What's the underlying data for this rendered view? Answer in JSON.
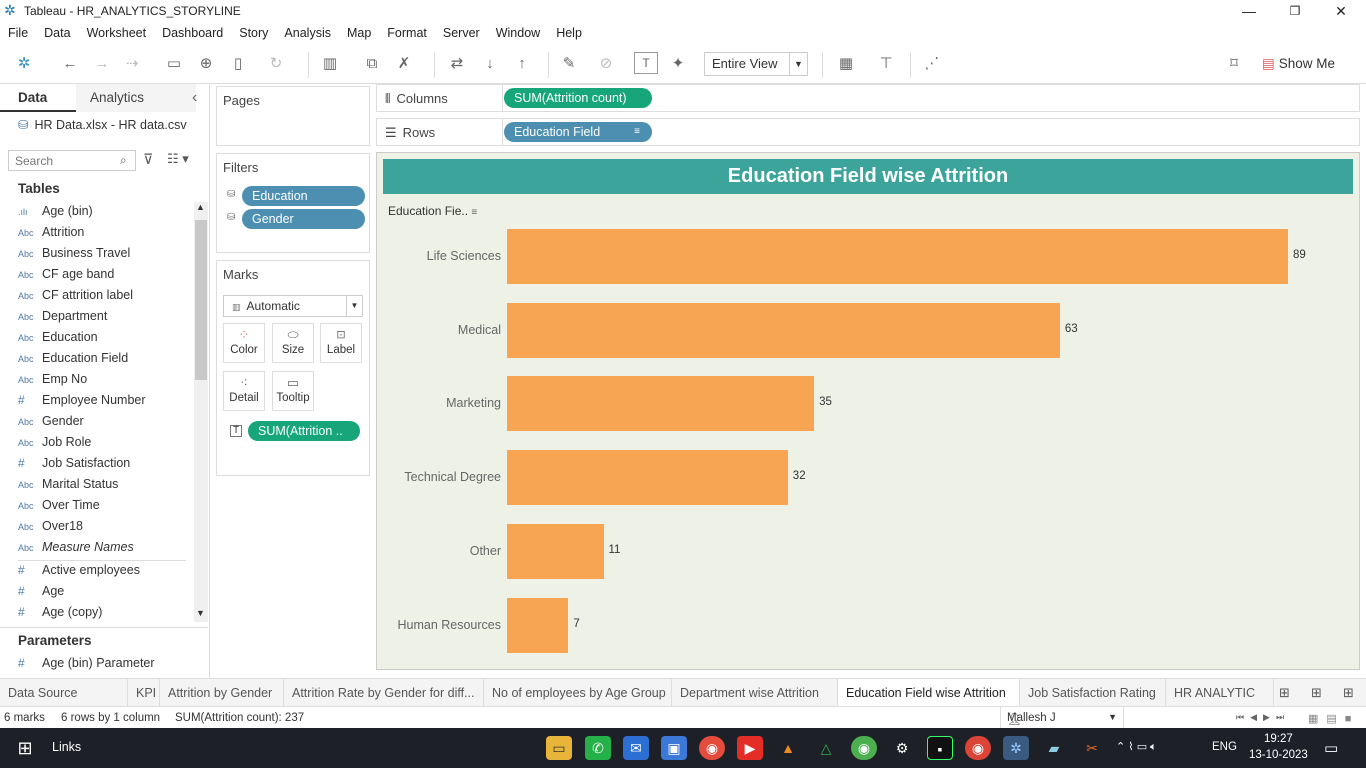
{
  "window": {
    "title": "Tableau - HR_ANALYTICS_STORYLINE",
    "minimize": "—",
    "restore": "❐",
    "close": "✕"
  },
  "menu": [
    "File",
    "Data",
    "Worksheet",
    "Dashboard",
    "Story",
    "Analysis",
    "Map",
    "Format",
    "Server",
    "Window",
    "Help"
  ],
  "toolbar": {
    "fit_label": "Entire View",
    "show_me_label": "Show Me"
  },
  "left_pane": {
    "tab_data": "Data",
    "tab_analytics": "Analytics",
    "collapse_icon": "‹",
    "datasource": "HR Data.xlsx - HR data.csv",
    "search_placeholder": "Search",
    "tables_header": "Tables",
    "fields": [
      {
        "type": "bin",
        "name": "Age (bin)"
      },
      {
        "type": "Abc",
        "name": "Attrition"
      },
      {
        "type": "Abc",
        "name": "Business Travel"
      },
      {
        "type": "Abc",
        "name": "CF age band"
      },
      {
        "type": "Abc",
        "name": "CF attrition label"
      },
      {
        "type": "Abc",
        "name": "Department"
      },
      {
        "type": "Abc",
        "name": "Education"
      },
      {
        "type": "Abc",
        "name": "Education Field"
      },
      {
        "type": "Abc",
        "name": "Emp No"
      },
      {
        "type": "#",
        "name": "Employee Number"
      },
      {
        "type": "Abc",
        "name": "Gender"
      },
      {
        "type": "Abc",
        "name": "Job Role"
      },
      {
        "type": "#",
        "name": "Job Satisfaction"
      },
      {
        "type": "Abc",
        "name": "Marital Status"
      },
      {
        "type": "Abc",
        "name": "Over Time"
      },
      {
        "type": "Abc",
        "name": "Over18"
      },
      {
        "type": "Abc",
        "name": "Measure Names"
      },
      {
        "type": "#",
        "name": "Active employees"
      },
      {
        "type": "#",
        "name": "Age"
      },
      {
        "type": "#",
        "name": "Age (copy)"
      }
    ],
    "parameters_header": "Parameters",
    "parameter": "Age (bin) Parameter"
  },
  "cards": {
    "pages_title": "Pages",
    "filters_title": "Filters",
    "filters": [
      "Education",
      "Gender"
    ],
    "marks_title": "Marks",
    "mark_type": "Automatic",
    "mark_buttons": [
      "Color",
      "Size",
      "Label",
      "Detail",
      "Tooltip"
    ],
    "mark_pill": "SUM(Attrition .."
  },
  "shelves": {
    "columns_label": "Columns",
    "columns_pill": "SUM(Attrition count)",
    "rows_label": "Rows",
    "rows_pill": "Education Field"
  },
  "chart_data": {
    "type": "bar",
    "title": "Education Field wise Attrition",
    "row_header": "Education Fie..",
    "categories": [
      "Life Sciences",
      "Medical",
      "Marketing",
      "Technical Degree",
      "Other",
      "Human Resources"
    ],
    "values": [
      89,
      63,
      35,
      32,
      11,
      7
    ],
    "bar_color": "#f7a552",
    "title_bg": "#3da49c",
    "pane_bg": "#edf1e6"
  },
  "sheet_tabs": [
    {
      "label": "Data Source",
      "active": false
    },
    {
      "label": "KPI",
      "active": false
    },
    {
      "label": "Attrition by Gender",
      "active": false
    },
    {
      "label": "Attrition Rate by Gender for diff...",
      "active": false
    },
    {
      "label": "No of employees by Age Group",
      "active": false
    },
    {
      "label": "Department wise Attrition",
      "active": false
    },
    {
      "label": "Education Field wise Attrition",
      "active": true
    },
    {
      "label": "Job Satisfaction Rating",
      "active": false
    },
    {
      "label": "HR ANALYTIC",
      "active": false
    }
  ],
  "status": {
    "marks": "6 marks",
    "rows": "6 rows by 1 column",
    "sum": "SUM(Attrition count): 237",
    "user": "Mallesh J"
  },
  "taskbar": {
    "links": "Links",
    "lang": "ENG",
    "time": "19:27",
    "date": "13-10-2023"
  }
}
